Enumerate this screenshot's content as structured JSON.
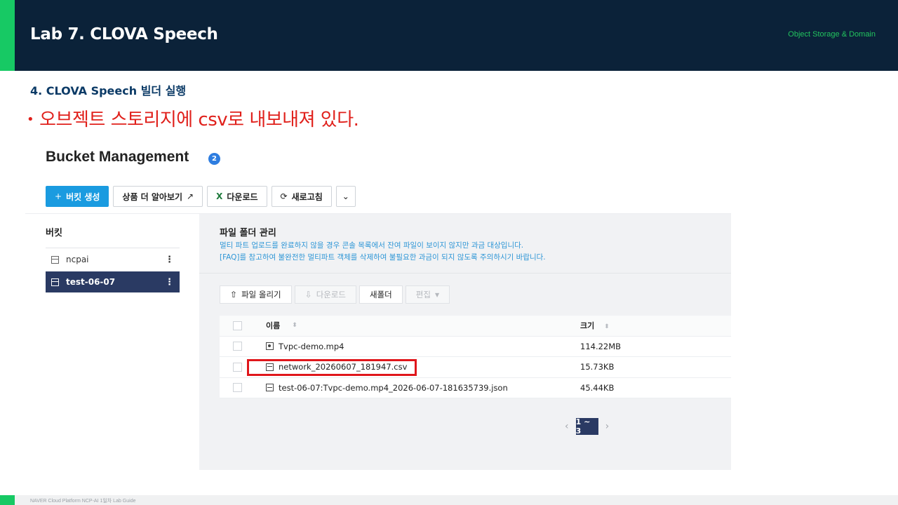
{
  "slide": {
    "title": "Lab 7. CLOVA Speech",
    "tag": "Object Storage & Domain",
    "section": "4.  CLOVA Speech 빌더 실행",
    "bullet_text": "오브젝트 스토리지에 csv로 내보내져 있다.",
    "footer": "NAVER Cloud Platform  NCP-AI 1일차 Lab Guide"
  },
  "console": {
    "title": "Bucket Management",
    "badge": "2",
    "toolbar": {
      "create": "버킷 생성",
      "learn_more": "상품 더 알아보기",
      "download": "다운로드",
      "refresh": "새로고침"
    },
    "sidebar": {
      "heading": "버킷",
      "items": [
        {
          "label": "ncpai"
        },
        {
          "label": "test-06-07"
        }
      ]
    },
    "panel": {
      "heading": "파일 폴더 관리",
      "note1": "멀티 파트 업로드를 완료하지 않을 경우 콘솔 목록에서 잔여 파일이 보이지 않지만 과금 대상입니다.",
      "note2": "[FAQ]를 참고하여 불완전한 멀티파트 객체를 삭제하여 불필요한 과금이 되지 않도록 주의하시기 바랍니다.",
      "file_toolbar": {
        "upload": "파일 올리기",
        "download": "다운로드",
        "new_folder": "새폴더",
        "edit": "편집"
      },
      "table": {
        "col_name": "이름",
        "col_size": "크기",
        "rows": [
          {
            "name": "Tvpc-demo.mp4",
            "size": "114.22MB"
          },
          {
            "name": "network_20260607_181947.csv",
            "size": "15.73KB"
          },
          {
            "name": "test-06-07:Tvpc-demo.mp4_2026-06-07-181635739.json",
            "size": "45.44KB"
          }
        ]
      },
      "pager": "1 ~ 3"
    }
  },
  "colors": {
    "header_bg": "#0b2239",
    "accent_green": "#17c964",
    "bullet_red": "#e0201b",
    "primary_blue": "#1a9be0",
    "active_navy": "#2a3a63"
  }
}
